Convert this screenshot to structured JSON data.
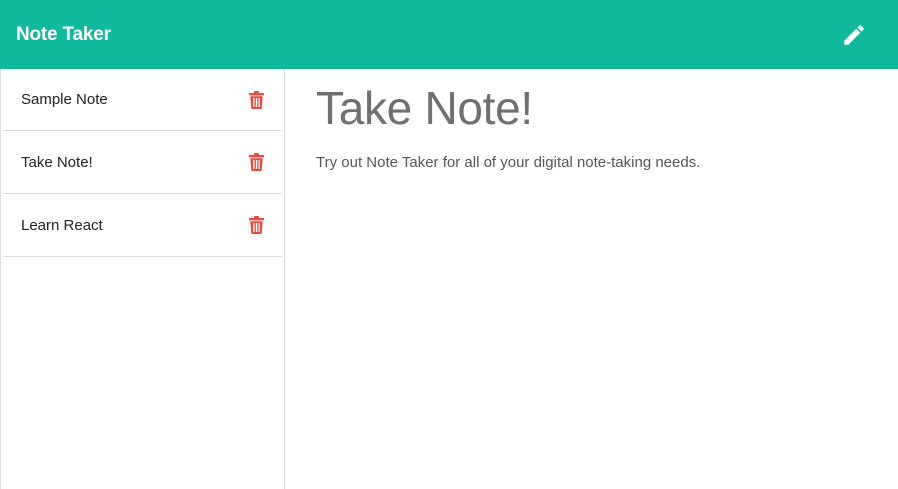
{
  "header": {
    "brand": "Note Taker",
    "new_note_icon": "pencil-icon"
  },
  "sidebar": {
    "notes": [
      {
        "title": "Sample Note",
        "delete_icon": "trash-icon"
      },
      {
        "title": "Take Note!",
        "delete_icon": "trash-icon"
      },
      {
        "title": "Learn React",
        "delete_icon": "trash-icon"
      }
    ]
  },
  "main": {
    "title": "Take Note!",
    "text": "Try out Note Taker for all of your digital note-taking needs."
  },
  "colors": {
    "accent": "#0fba9b",
    "danger": "#e74c3c"
  }
}
